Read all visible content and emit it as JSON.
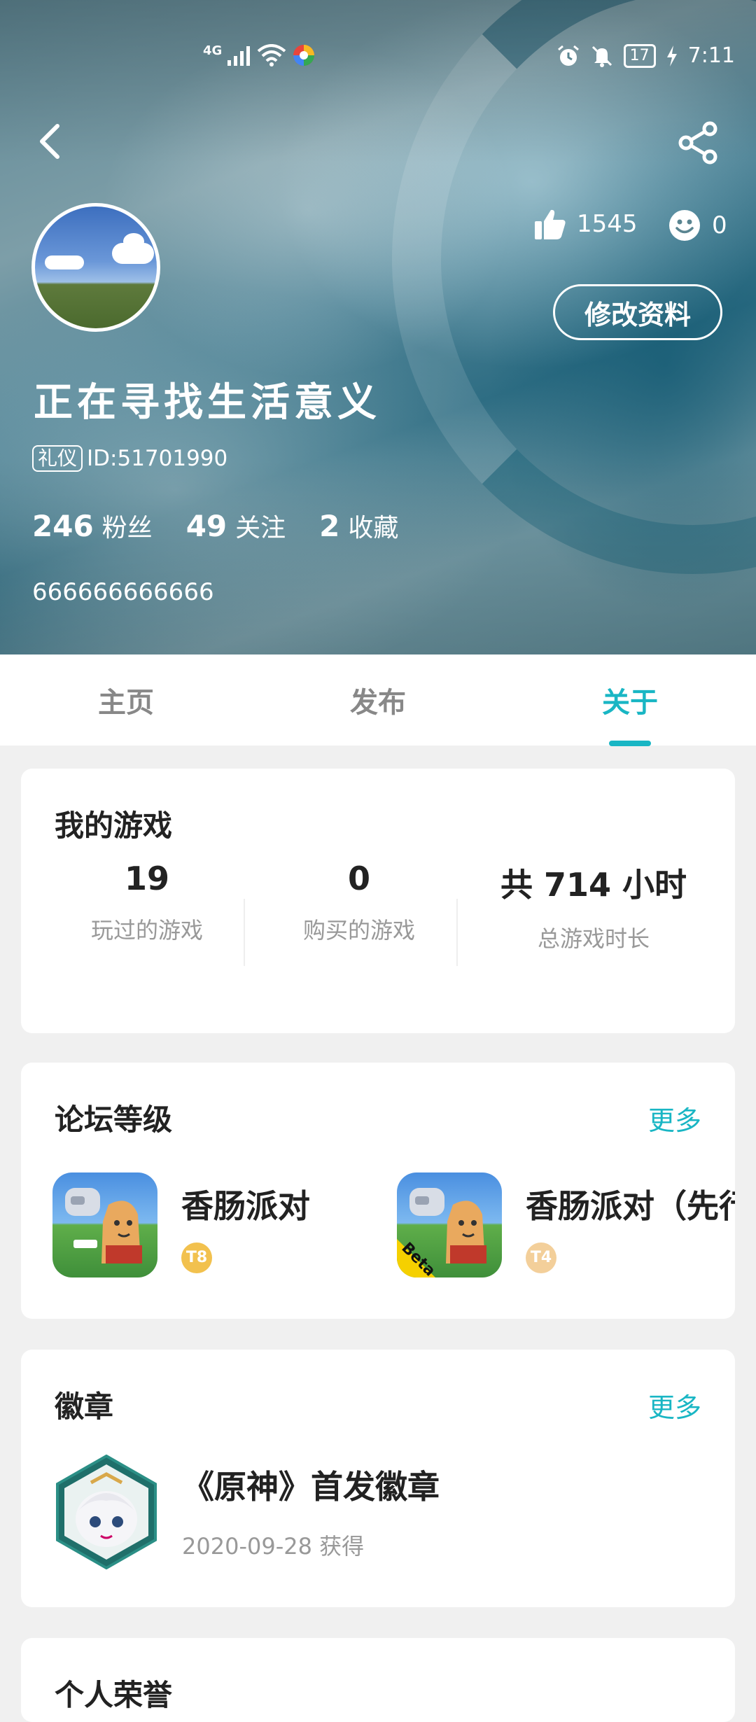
{
  "status_bar": {
    "network": "4G",
    "battery": "17",
    "time": "7:11"
  },
  "profile": {
    "nickname": "正在寻找生活意义",
    "tag": "礼仪",
    "id_text": "ID:51701990",
    "likes": "1545",
    "reactions": "0",
    "edit_button": "修改资料",
    "stats": [
      {
        "num": "246",
        "label": "粉丝"
      },
      {
        "num": "49",
        "label": "关注"
      },
      {
        "num": "2",
        "label": "收藏"
      }
    ],
    "bio": "666666666666"
  },
  "tabs": [
    "主页",
    "发布",
    "关于"
  ],
  "active_tab": "关于",
  "my_games": {
    "title": "我的游戏",
    "stats": [
      {
        "num": "19",
        "label": "玩过的游戏"
      },
      {
        "num": "0",
        "label": "购买的游戏"
      },
      {
        "num": "共 714 小时",
        "label": "总游戏时长"
      }
    ]
  },
  "forum_level": {
    "title": "论坛等级",
    "more": "更多",
    "items": [
      {
        "name": "香肠派对",
        "level": "T8",
        "icon": "sausage-party-icon"
      },
      {
        "name": "香肠派对（先行服）",
        "level": "T4",
        "icon": "sausage-party-beta-icon",
        "beta_label": "Beta"
      }
    ]
  },
  "badges": {
    "title": "徽章",
    "more": "更多",
    "item": {
      "name": "《原神》首发徽章",
      "date": "2020-09-28 获得",
      "icon": "genshin-paimon-badge-icon"
    }
  },
  "next_card": {
    "title": "个人荣誉"
  },
  "colors": {
    "accent": "#19b6c4",
    "level_gold": "#f2c14e"
  }
}
